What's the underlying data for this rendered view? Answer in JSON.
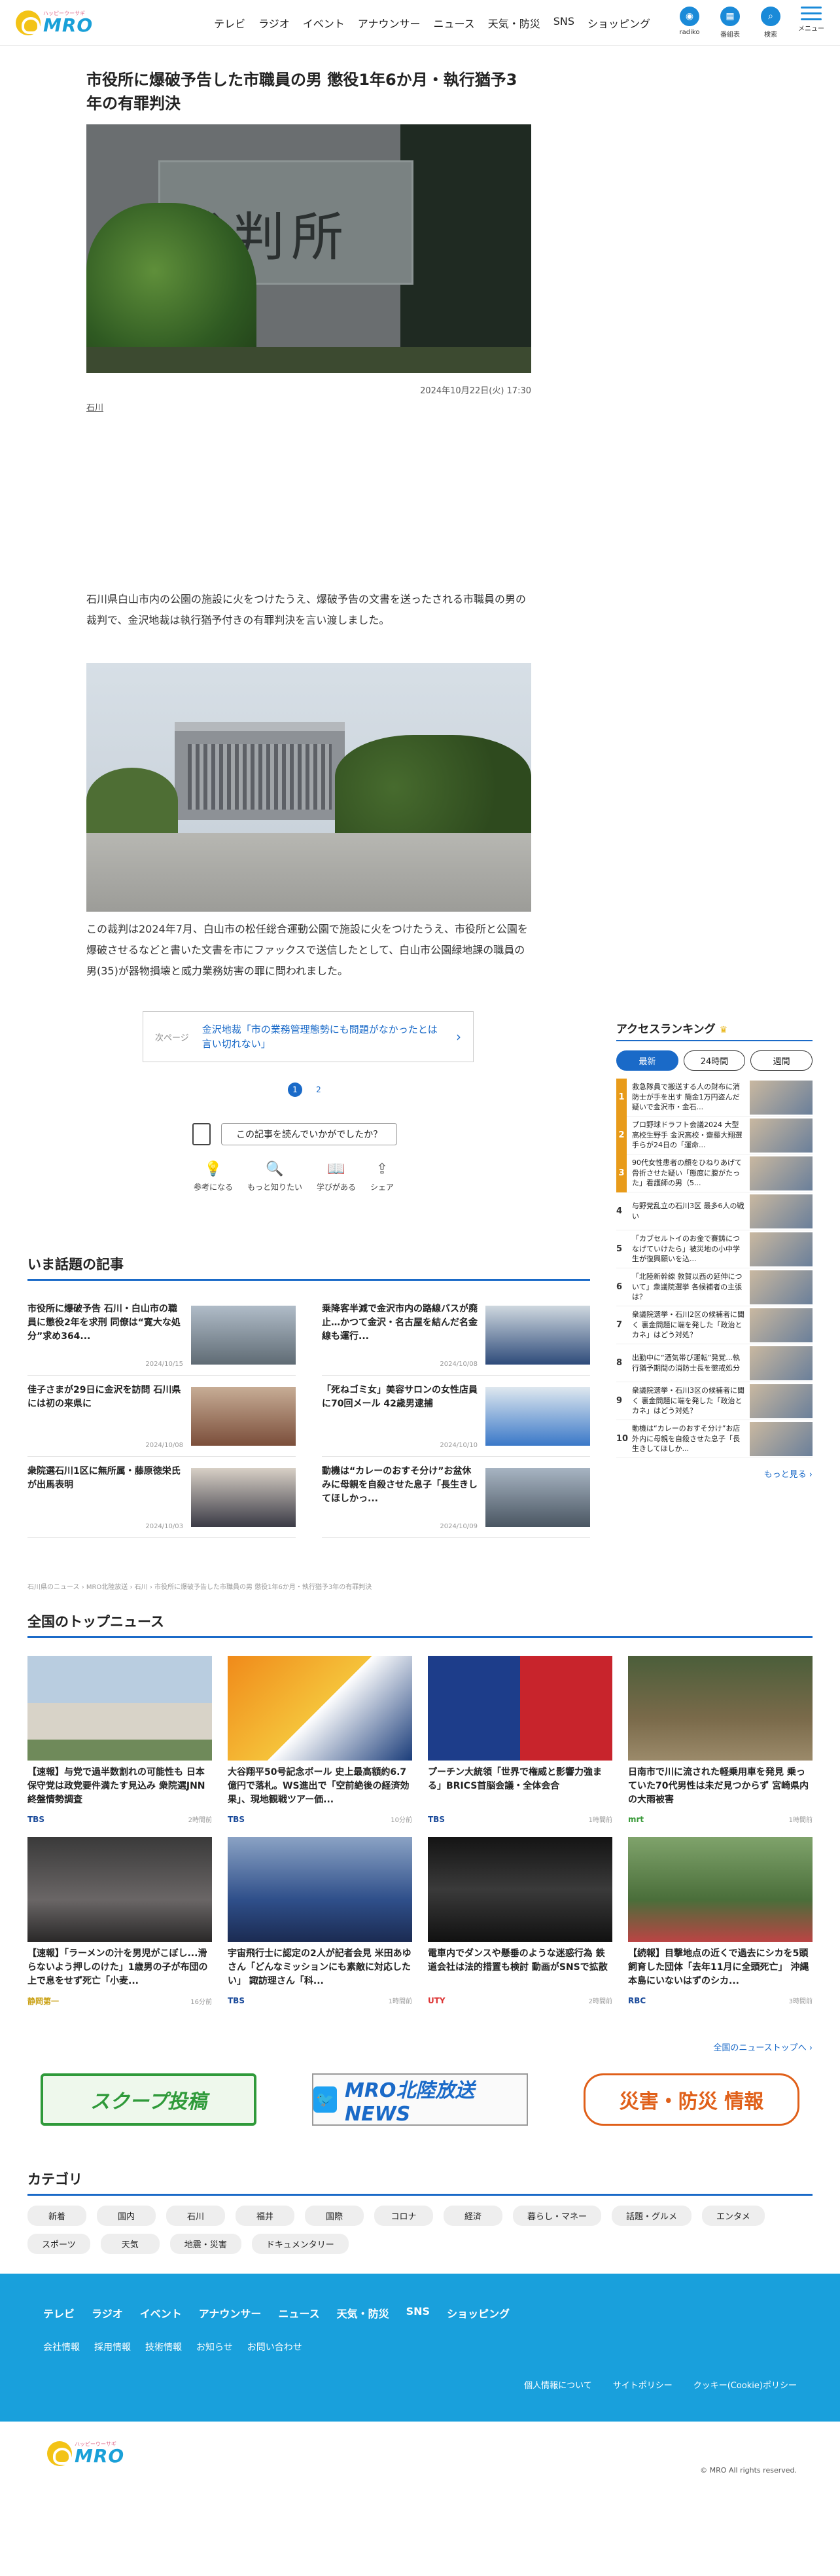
{
  "header": {
    "logo_sub": "ハッピーウーサギ",
    "logo_main": "MRO",
    "nav": [
      "テレビ",
      "ラジオ",
      "イベント",
      "アナウンサー",
      "ニュース",
      "天気・防災",
      "SNS",
      "ショッピング"
    ],
    "icons": [
      {
        "icon": "radiko-icon",
        "label": "radiko"
      },
      {
        "icon": "program-guide-icon",
        "label": "番組表"
      },
      {
        "icon": "search-icon",
        "label": "検索"
      }
    ],
    "menu_label": "メニュー"
  },
  "article": {
    "title": "市役所に爆破予告した市職員の男 懲役1年6か月・執行猶予3年の有罪判決",
    "photo1_sign": "裁判所",
    "date": "2024年10月22日(火) 17:30",
    "tag": "石川",
    "lead": "石川県白山市内の公園の施設に火をつけたうえ、爆破予告の文書を送ったされる市職員の男の裁判で、金沢地裁は執行猶予付きの有罪判決を言い渡しました。",
    "body2": "この裁判は2024年7月、白山市の松任総合運動公園で施設に火をつけたうえ、市役所と公園を爆破させるなどと書いた文書を市にファックスで送信したとして、白山市公園緑地課の職員の男(35)が器物損壊と威力業務妨害の罪に問われました。",
    "next_kicker": "次ページ",
    "next_title": "金沢地裁「市の業務管理態勢にも問題がなかったとは言い切れない」",
    "pages": [
      "1",
      "2"
    ],
    "feedback_question": "この記事を読んでいかがでしたか？",
    "reactions": [
      {
        "icon": "bulb-icon",
        "glyph": "💡",
        "label": "参考になる"
      },
      {
        "icon": "search-icon",
        "glyph": "🔍",
        "label": "もっと知りたい"
      },
      {
        "icon": "book-icon",
        "glyph": "📖",
        "label": "学びがある"
      },
      {
        "icon": "share-icon",
        "glyph": "⇪",
        "label": "シェア"
      }
    ]
  },
  "ranking": {
    "title": "アクセスランキング",
    "tabs": [
      "最新",
      "24時間",
      "週間"
    ],
    "items": [
      {
        "n": "1",
        "text": "救急隊員で搬送する人の財布に消防士が手を出す 簡金1万円盗んだ疑いで金沢市・金石..."
      },
      {
        "n": "2",
        "text": "プロ野球ドラフト会議2024 大型高校生野手 金沢高校・齋藤大翔選手らが24日の「運命..."
      },
      {
        "n": "3",
        "text": "90代女性患者の顔をひねりあげて骨折させた疑い「態度に腹がたった」看護師の男（5..."
      },
      {
        "n": "4",
        "text": "与野党乱立の石川3区 最多6人の戦い"
      },
      {
        "n": "5",
        "text": "「カブセルトイのお金で賽鋳につなげていけたら」被災地の小中学生が復興願いを込..."
      },
      {
        "n": "6",
        "text": "「北陸新幹線 敦賀以西の延伸について」衆議院選挙 各候補者の主張は？"
      },
      {
        "n": "7",
        "text": "衆議院選挙・石川2区の候補者に聞く 裏金問題に端を発した「政治とカネ」はどう対処？"
      },
      {
        "n": "8",
        "text": "出勤中に“酒気帯び運転”発覚...執行猶予期間の消防士長を懲戒処分"
      },
      {
        "n": "9",
        "text": "衆議院選挙・石川3区の候補者に聞く 裏金問題に端を発した「政治とカネ」はどう対処？"
      },
      {
        "n": "10",
        "text": "動機は“カレーのおすそ分け”お店外内に母親を自殺させた息子「長生きしてほしか..."
      }
    ],
    "more": "もっと見る ›"
  },
  "trending": {
    "title": "いま話題の記事",
    "items": [
      {
        "text": "市役所に爆破予告 石川・白山市の職員に懲役2年を求刑 同僚は“寛大な処分”求め364...",
        "date": "2024/10/15"
      },
      {
        "text": "乗降客半減で金沢市内の路線バスが廃止…かつて金沢・名古屋を結んだ名金線も運行...",
        "date": "2024/10/08"
      },
      {
        "text": "佳子さまが29日に金沢を訪問 石川県には初の来県に",
        "date": "2024/10/08"
      },
      {
        "text": "「死ねゴミ女」美容サロンの女性店員に70回メール 42歳男逮捕",
        "date": "2024/10/10"
      },
      {
        "text": "衆院選石川1区に無所属・藤原徳栄氏が出馬表明",
        "date": "2024/10/03"
      },
      {
        "text": "動機は“カレーのおすそ分け”お盆休みに母親を自殺させた息子「長生きしてほしかっ...",
        "date": "2024/10/09"
      }
    ]
  },
  "breadcrumb": "石川県のニュース › MRO北陸放送 › 石川 › 市役所に爆破予告した市職員の男 懲役1年6か月・執行猶予3年の有罪判決",
  "national": {
    "title": "全国のトップニュース",
    "items": [
      {
        "text": "【速報】与党で過半数割れの可能性も 日本保守党は政党要件満たす見込み 衆院選JNN終盤情勢調査",
        "source": "TBS",
        "time": "2時間前",
        "pic": "diet"
      },
      {
        "text": "大谷翔平50号記念ボール 史上最高額約6.7億円で落札。WS進出で「空前絶後の経済効果」、現地観戦ツアー価...",
        "source": "TBS",
        "time": "10分前",
        "pic": "ohtani"
      },
      {
        "text": "プーチン大統領「世界で権威と影響力強まる」BRICS首脳会議・全体会合",
        "source": "TBS",
        "time": "1時間前",
        "pic": "putin"
      },
      {
        "text": "日南市で川に流された軽乗用車を発見 乗っていた70代男性は未だ見つからず 宮崎県内の大雨被害",
        "source": "mrt",
        "time": "1時間前",
        "pic": "flood"
      },
      {
        "text": "【速報】「ラーメンの汁を男児がこぼし...滑らないよう押しのけた」1歳男の子が布団の上で息をせず死亡「小麦...",
        "source": "静岡第一",
        "time": "16分前",
        "pic": "room"
      },
      {
        "text": "宇宙飛行士に認定の2人が記者会見 米田あゆさん「どんなミッションにも素敵に対応したい」 諏訪理さん「科...",
        "source": "TBS",
        "time": "1時間前",
        "pic": "astro"
      },
      {
        "text": "電車内でダンスや懸垂のような迷惑行為 鉄道会社は法的措置も検討 動画がSNSで拡散",
        "source": "UTY",
        "time": "2時間前",
        "pic": "train"
      },
      {
        "text": "【続報】目撃地点の近くで過去にシカを5頭飼育した団体「去年11月に全頭死亡」 沖縄本島にいないはずのシカ...",
        "source": "RBC",
        "time": "3時間前",
        "pic": "deer"
      }
    ],
    "more": "全国のニューストップへ ›"
  },
  "banners": [
    "スクープ投稿",
    "MRO北陸放送 NEWS",
    "災害・防災 情報"
  ],
  "categories": {
    "title": "カテゴリ",
    "items": [
      "新着",
      "国内",
      "石川",
      "福井",
      "国際",
      "コロナ",
      "経済",
      "暮らし・マネー",
      "話題・グルメ",
      "エンタメ",
      "スポーツ",
      "天気",
      "地震・災害",
      "ドキュメンタリー"
    ]
  },
  "footer": {
    "nav": [
      "テレビ",
      "ラジオ",
      "イベント",
      "アナウンサー",
      "ニュース",
      "天気・防災",
      "SNS",
      "ショッピング"
    ],
    "sub": [
      "会社情報",
      "採用情報",
      "技術情報",
      "お知らせ",
      "お問い合わせ"
    ],
    "legal": [
      "個人情報について",
      "サイトポリシー",
      "クッキー(Cookie)ポリシー"
    ],
    "copyright": "© MRO All rights reserved."
  },
  "colors": {
    "accent": "#1a6ac8",
    "footer": "#19a0dc",
    "logo": "#1aa0d8"
  }
}
